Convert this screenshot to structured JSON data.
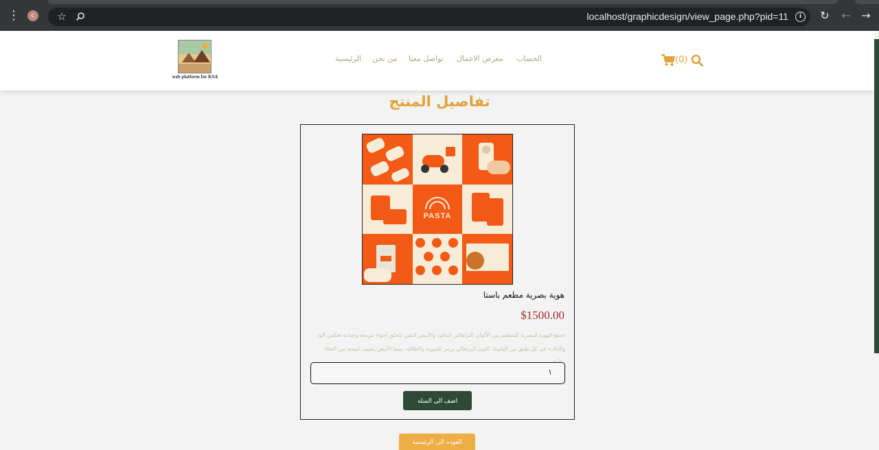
{
  "browser": {
    "profile_initial": "c",
    "url": "localhost/graphicdesign/view_page.php?pid=11"
  },
  "header": {
    "logo_caption": "web platform for KSA",
    "nav": {
      "account": "الحساب",
      "gallery": "معرض الاعمال",
      "contact": "تواصل معنا",
      "about": "من نحن",
      "home": "الرئيسية"
    },
    "cart_count": "(0)"
  },
  "page": {
    "title": "تفاصيل المنتج"
  },
  "product": {
    "name": "هوية بصرية مطعم باستا",
    "price": "$1500.00",
    "description": "تجمع الهوية البصرية للمطعم بين الألوان البرتقالي الدافئ والأبيض النقي لتخلق أجواء مريحة وجذابة تعكس الود والدفء في كل طبق من الباستا. اللون البرتقالي يرمز للحيوية والطاقة، بينما الأبيض يضيف لمسة من النقاء والأناقة.",
    "image_text": "PASTA",
    "quantity": "١",
    "add_to_cart": "اضف الى السله"
  },
  "back_home": "العوده الى الرئيسية",
  "colors": {
    "accent": "#e2a23a",
    "primary_dark": "#2c4a36",
    "price": "#a42727",
    "image_orange": "#f25a16"
  }
}
